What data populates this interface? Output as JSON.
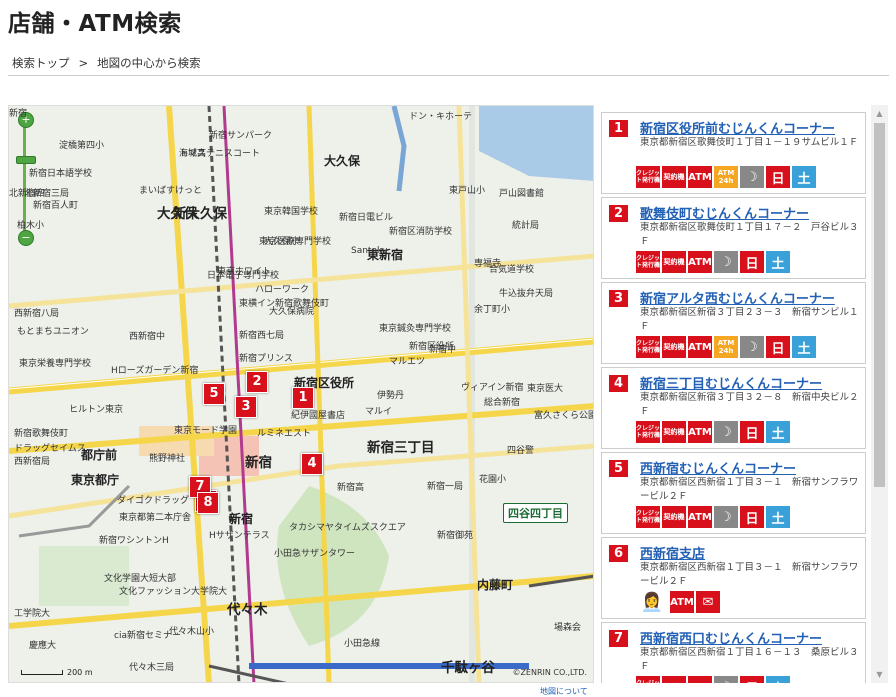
{
  "page": {
    "title": "店舗・ATM検索",
    "breadcrumb": [
      "検索トップ",
      "地図の中心から検索"
    ],
    "map_footer_link": "地図について"
  },
  "map": {
    "scale_label": "200 m",
    "copyright": "©ZENRIN CO.,LTD.",
    "place_labels": [
      {
        "text": "大久保",
        "cls": "mid"
      },
      {
        "text": "大久保",
        "cls": "big"
      },
      {
        "text": "新大久保",
        "cls": "big"
      },
      {
        "text": "東新宿",
        "cls": "mid"
      },
      {
        "text": "新宿区役所",
        "cls": "mid"
      },
      {
        "text": "新宿三丁目",
        "cls": "big"
      },
      {
        "text": "新宿",
        "cls": "big"
      },
      {
        "text": "都庁前",
        "cls": "mid"
      },
      {
        "text": "東京都庁",
        "cls": "mid"
      },
      {
        "text": "新宿",
        "cls": "mid"
      },
      {
        "text": "代々木",
        "cls": "big"
      },
      {
        "text": "千駄ヶ谷",
        "cls": "big"
      },
      {
        "text": "内藤町",
        "cls": "mid"
      },
      {
        "text": "四谷四丁目",
        "cls": ""
      },
      {
        "text": "ドン・キホーテ",
        "cls": ""
      },
      {
        "text": "新宿サンパーク",
        "cls": ""
      },
      {
        "text": "海城高",
        "cls": ""
      },
      {
        "text": "淀橋第四小",
        "cls": ""
      },
      {
        "text": "トマステニスコート",
        "cls": ""
      },
      {
        "text": "北新宿四",
        "cls": ""
      },
      {
        "text": "北新宿三局",
        "cls": ""
      },
      {
        "text": "まいばすけっと",
        "cls": ""
      },
      {
        "text": "柏木小",
        "cls": ""
      },
      {
        "text": "東京韓国学校",
        "cls": ""
      },
      {
        "text": "新宿日本語学校",
        "cls": ""
      },
      {
        "text": "新宿百人町",
        "cls": ""
      },
      {
        "text": "東京医療専門学校",
        "cls": ""
      },
      {
        "text": "東京ホワイト",
        "cls": ""
      },
      {
        "text": "日本電子専門学校",
        "cls": ""
      },
      {
        "text": "ハローワーク",
        "cls": ""
      },
      {
        "text": "大久保病院",
        "cls": ""
      },
      {
        "text": "東横イン新宿歌舞伎町",
        "cls": ""
      },
      {
        "text": "西新宿八局",
        "cls": ""
      },
      {
        "text": "もとまちユニオン",
        "cls": ""
      },
      {
        "text": "西新宿中",
        "cls": ""
      },
      {
        "text": "新宿西七局",
        "cls": ""
      },
      {
        "text": "新宿プリンス",
        "cls": ""
      },
      {
        "text": "Hローズガーデン新宿",
        "cls": ""
      },
      {
        "text": "東京栄養専門学校",
        "cls": ""
      },
      {
        "text": "ヒルトン東京",
        "cls": ""
      },
      {
        "text": "紀伊國屋書店",
        "cls": ""
      },
      {
        "text": "ルミネエスト",
        "cls": ""
      },
      {
        "text": "東京モード学園",
        "cls": ""
      },
      {
        "text": "ダイゴクドラッグ",
        "cls": ""
      },
      {
        "text": "東京都第二本庁舎",
        "cls": ""
      },
      {
        "text": "新宿ワシントンH",
        "cls": ""
      },
      {
        "text": "Hサザンテラス",
        "cls": ""
      },
      {
        "text": "タカシマヤタイムズスクエア",
        "cls": ""
      },
      {
        "text": "小田急サザンタワー",
        "cls": ""
      },
      {
        "text": "文化学園大短大部",
        "cls": ""
      },
      {
        "text": "文化ファッション大学院大",
        "cls": ""
      },
      {
        "text": "新宿御苑",
        "cls": ""
      },
      {
        "text": "マルイ",
        "cls": ""
      },
      {
        "text": "伊勢丹",
        "cls": ""
      },
      {
        "text": "ヴィアイン新宿",
        "cls": ""
      },
      {
        "text": "東京医大",
        "cls": ""
      },
      {
        "text": "総合新宿",
        "cls": ""
      },
      {
        "text": "富久さくら公園",
        "cls": ""
      },
      {
        "text": "四谷警",
        "cls": ""
      },
      {
        "text": "花園小",
        "cls": ""
      },
      {
        "text": "新宿一局",
        "cls": ""
      },
      {
        "text": "新宿高",
        "cls": ""
      },
      {
        "text": "東戸山小",
        "cls": ""
      },
      {
        "text": "戸山図書館",
        "cls": ""
      },
      {
        "text": "牛込抜弁天局",
        "cls": ""
      },
      {
        "text": "余丁町小",
        "cls": ""
      },
      {
        "text": "合気道学校",
        "cls": ""
      },
      {
        "text": "新宿区役所",
        "cls": ""
      },
      {
        "text": "新宿中",
        "cls": ""
      },
      {
        "text": "統計局",
        "cls": ""
      },
      {
        "text": "専福寺",
        "cls": ""
      },
      {
        "text": "新宿日電ビル",
        "cls": ""
      },
      {
        "text": "新宿区消防学校",
        "cls": ""
      },
      {
        "text": "Santoku",
        "cls": ""
      },
      {
        "text": "大久保小",
        "cls": ""
      },
      {
        "text": "東京鍼灸専門学校",
        "cls": ""
      },
      {
        "text": "マルエツ",
        "cls": ""
      },
      {
        "text": "新宿歌舞伎町",
        "cls": ""
      },
      {
        "text": "ドラッグセイムス",
        "cls": ""
      },
      {
        "text": "西新宿局",
        "cls": ""
      },
      {
        "text": "熊野神社",
        "cls": ""
      },
      {
        "text": "工学院大",
        "cls": ""
      },
      {
        "text": "cia新宿セミナー",
        "cls": ""
      },
      {
        "text": "代々木三局",
        "cls": ""
      },
      {
        "text": "代々木山小",
        "cls": ""
      },
      {
        "text": "小田急線",
        "cls": ""
      },
      {
        "text": "場森会",
        "cls": ""
      },
      {
        "text": "慶應大",
        "cls": ""
      },
      {
        "text": "新宿",
        "cls": ""
      }
    ]
  },
  "markers": [
    "1",
    "2",
    "3",
    "4",
    "5",
    "6",
    "7",
    "8"
  ],
  "stores": [
    {
      "num": "1",
      "name": "新宿区役所前むじんくんコーナー",
      "address": "東京都新宿区歌舞伎町１丁目１－１９サムビル１Ｆ",
      "icons": [
        "credit",
        "keiyaku",
        "atm",
        "h24",
        "moon",
        "sun",
        "sat"
      ]
    },
    {
      "num": "2",
      "name": "歌舞伎町むじんくんコーナー",
      "address": "東京都新宿区歌舞伎町１丁目１７－２　戸谷ビル３Ｆ",
      "icons": [
        "credit",
        "keiyaku",
        "atm",
        "moon",
        "sun",
        "sat"
      ]
    },
    {
      "num": "3",
      "name": "新宿アルタ西むじんくんコーナー",
      "address": "東京都新宿区新宿３丁目２３－３　新宿サンビル１Ｆ",
      "icons": [
        "credit",
        "keiyaku",
        "atm",
        "h24",
        "moon",
        "sun",
        "sat"
      ]
    },
    {
      "num": "4",
      "name": "新宿三丁目むじんくんコーナー",
      "address": "東京都新宿区新宿３丁目３２－８　新宿中央ビル２Ｆ",
      "icons": [
        "credit",
        "keiyaku",
        "atm",
        "moon",
        "sun",
        "sat"
      ]
    },
    {
      "num": "5",
      "name": "西新宿むじんくんコーナー",
      "address": "東京都新宿区西新宿１丁目３－１　新宿サンフラワービル２Ｆ",
      "icons": [
        "credit",
        "keiyaku",
        "atm",
        "moon",
        "sun",
        "sat"
      ]
    },
    {
      "num": "6",
      "name": "西新宿支店",
      "address": "東京都新宿区西新宿１丁目３－１　新宿サンフラワービル２Ｆ",
      "icons": [
        "staff",
        "atm",
        "mail"
      ]
    },
    {
      "num": "7",
      "name": "西新宿西口むじんくんコーナー",
      "address": "東京都新宿区西新宿１丁目１６－１３　桑原ビル３Ｆ",
      "icons": [
        "credit",
        "keiyaku",
        "atm",
        "moon",
        "sun",
        "sat"
      ]
    }
  ],
  "icon_text": {
    "credit": "クレジット発行機",
    "keiyaku": "契約機",
    "atm": "ATM",
    "h24_top": "ATM",
    "h24_bottom": "24h",
    "moon": "☽",
    "sun": "日",
    "sat": "土",
    "staff": "👩‍💼",
    "mail": "✉"
  },
  "colors": {
    "brand_red": "#d7101c",
    "link_blue": "#2160b5",
    "saturday_blue": "#3aa0d8",
    "night_gray": "#888888",
    "atm24_orange": "#f5a623",
    "map_zoom_green": "#4da642"
  }
}
